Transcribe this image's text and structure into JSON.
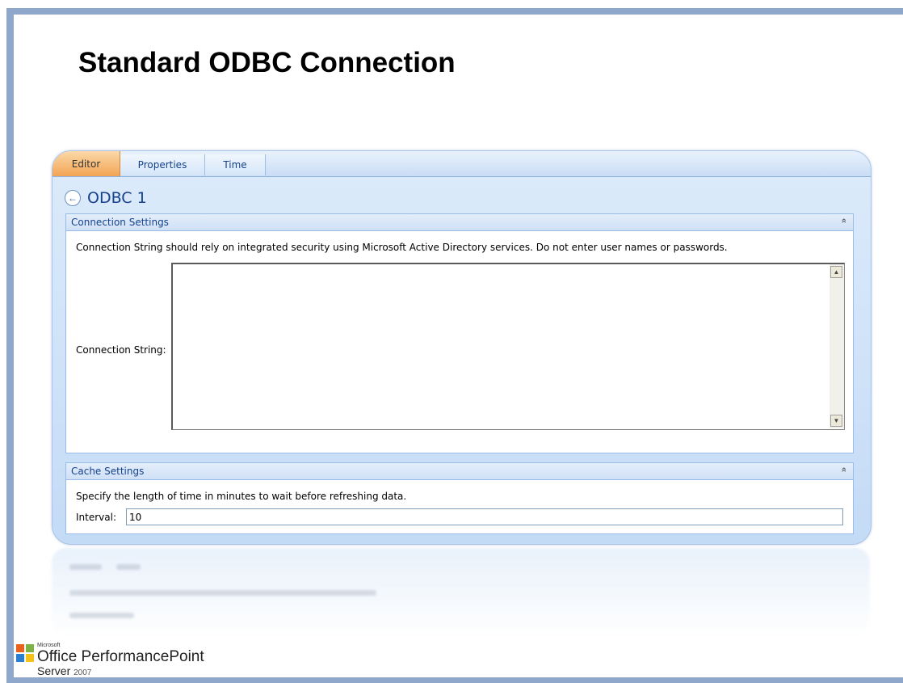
{
  "slide": {
    "title": "Standard ODBC Connection"
  },
  "tabs": [
    {
      "label": "Editor",
      "active": true
    },
    {
      "label": "Properties",
      "active": false
    },
    {
      "label": "Time",
      "active": false
    }
  ],
  "header": {
    "title": "ODBC 1"
  },
  "connection_panel": {
    "title": "Connection Settings",
    "help_text": "Connection String should rely on integrated security using Microsoft Active Directory services. Do not enter user names or passwords.",
    "field_label": "Connection String:",
    "field_value": ""
  },
  "cache_panel": {
    "title": "Cache Settings",
    "help_text": "Specify the length of time in minutes to wait before refreshing data.",
    "interval_label": "Interval:",
    "interval_value": "10"
  },
  "logo": {
    "microsoft": "Microsoft",
    "office": "Office PerformancePoint",
    "server": "Server",
    "year": "2007"
  },
  "colors": {
    "active_tab": "#f3a454",
    "frame_blue": "#8ea7cb",
    "header_text": "#15428b"
  },
  "icons": {
    "back": "back-arrow-icon",
    "collapse": "double-chevron-up-icon",
    "scroll_up": "scroll-up-arrow-icon",
    "scroll_down": "scroll-down-arrow-icon"
  }
}
